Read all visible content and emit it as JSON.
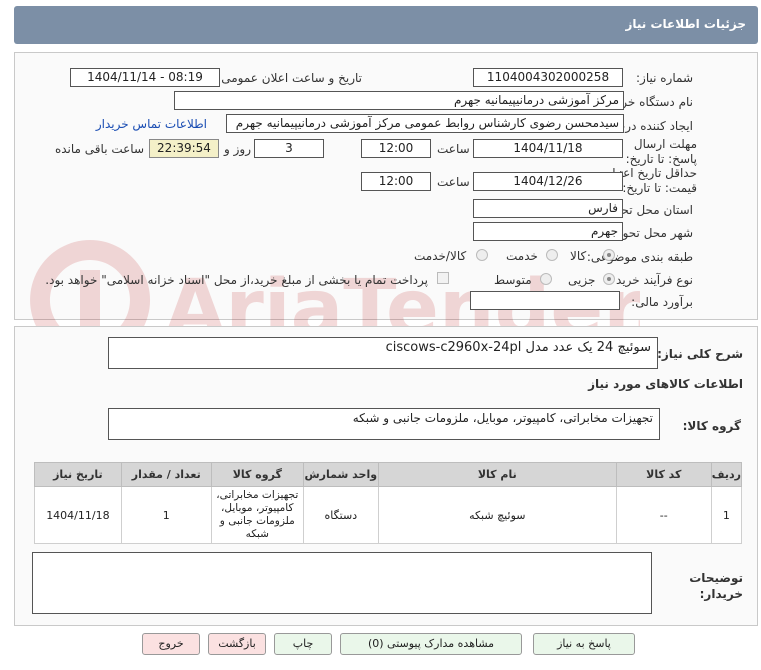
{
  "header": {
    "title": "جزئیات اطلاعات نیاز"
  },
  "form": {
    "need_number_label": "شماره نیاز:",
    "need_number": "1104004302000258",
    "announce_label": "تاریخ و ساعت اعلان عمومی:",
    "announce_value": "1404/11/14 - 08:19",
    "buyer_org_label": "نام دستگاه خریدار:",
    "buyer_org": "مرکز آموزشی درمانیپیمانیه جهرم",
    "creator_label": "ایجاد کننده درخواست:",
    "creator": "سیدمحسن رضوی کارشناس روابط عمومی مرکز آموزشی درمانیپیمانیه جهرم",
    "contact_link": "اطلاعات تماس خریدار",
    "deadline_label": "مهلت ارسال پاسخ: تا تاریخ:",
    "deadline_date": "1404/11/18",
    "time_label": "ساعت",
    "deadline_time": "12:00",
    "days_count": "3",
    "days_label": "روز و",
    "remaining_time": "22:39:54",
    "remaining_label": "ساعت باقی مانده",
    "validity_label": "حداقل تاریخ اعتبار قیمت: تا تاریخ:",
    "validity_date": "1404/12/26",
    "validity_time": "12:00",
    "province_label": "استان محل تحویل:",
    "province": "فارس",
    "city_label": "شهر محل تحویل:",
    "city": "جهرم",
    "category_label": "طبقه بندی موضوعی:",
    "category_options": [
      "کالا",
      "خدمت",
      "کالا/خدمت"
    ],
    "process_label": "نوع فرآیند خرید :",
    "process_options": [
      "جزیی",
      "متوسط"
    ],
    "payment_note": "پرداخت تمام یا بخشی از مبلغ خرید،از محل \"اسناد خزانه اسلامی\" خواهد بود.",
    "estimate_label": "برآورد مالی:",
    "estimate_value": ""
  },
  "summary": {
    "description_label": "شرح کلی نیاز:",
    "description": "سوئیچ 24 یک عدد مدل ciscows-c2960x-24pl",
    "items_title": "اطلاعات کالاهای مورد نیاز",
    "group_label": "گروه کالا:",
    "group_value": "تجهیزات مخابراتی، کامپیوتر، موبایل، ملزومات جانبی و شبکه"
  },
  "table": {
    "headers": [
      "ردیف",
      "کد کالا",
      "نام کالا",
      "واحد شمارش",
      "گروه کالا",
      "تعداد / مقدار",
      "تاریخ نیاز"
    ],
    "rows": [
      [
        "1",
        "--",
        "سوئیچ شبکه",
        "دستگاه",
        "تجهیزات مخابراتی، کامپیوتر، موبایل، ملزومات جانبی و شبکه",
        "1",
        "1404/11/18"
      ]
    ]
  },
  "buyer_notes": {
    "label": "توضیحات خریدار:",
    "value": ""
  },
  "buttons": {
    "reply": "پاسخ به نیاز",
    "attachments": "مشاهده مدارک پیوستی (0)",
    "print": "چاپ",
    "back": "بازگشت",
    "exit": "خروج"
  },
  "watermark": {
    "text": "AriaTender.neT"
  }
}
